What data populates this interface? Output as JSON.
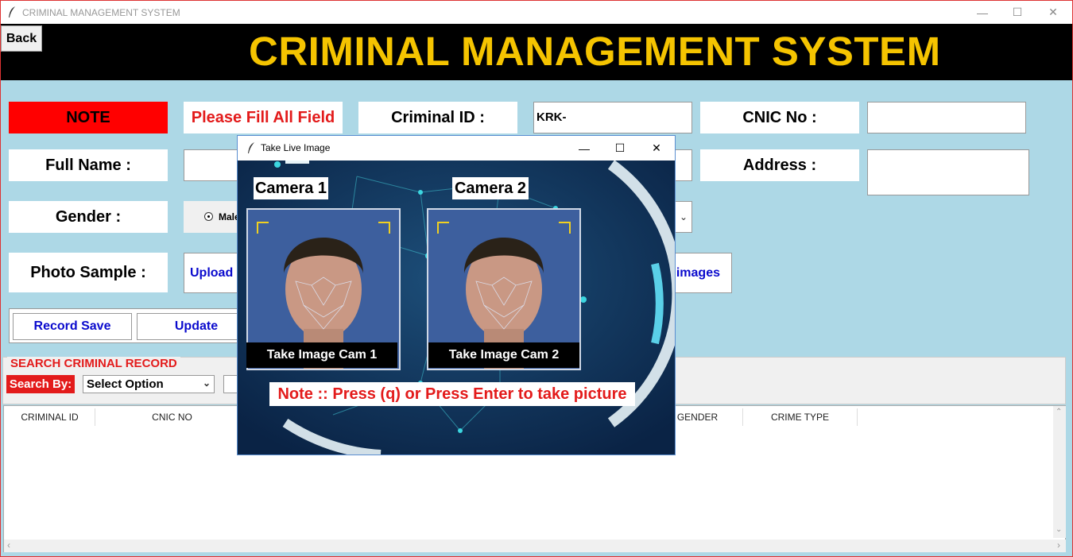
{
  "window": {
    "title": "CRIMINAL MANAGEMENT SYSTEM",
    "minimize": "—",
    "maximize": "☐",
    "close": "✕"
  },
  "header": {
    "back_label": "Back",
    "title": "CRIMINAL MANAGEMENT SYSTEM"
  },
  "form": {
    "note_label": "NOTE",
    "note_text": "Please Fill All Field",
    "criminal_id_label": "Criminal ID :",
    "criminal_id_value": "KRK-",
    "cnic_label": "CNIC No :",
    "cnic_value": "",
    "full_name_label": "Full Name :",
    "full_name_value": "",
    "address_label": "Address :",
    "address_value": "",
    "gender_label": "Gender :",
    "gender_option_male": "Male",
    "photo_label": "Photo Sample :",
    "upload_label": "Upload",
    "images_label": "images",
    "record_save_label": "Record Save",
    "update_label": "Update"
  },
  "search": {
    "frame_title": "SEARCH CRIMINAL RECORD",
    "search_by_label": "Search By:",
    "select_value": "Select Option"
  },
  "table": {
    "columns": [
      "CRIMINAL ID",
      "CNIC NO",
      "GENDER",
      "CRIME TYPE"
    ]
  },
  "dialog": {
    "title": "Take Live Image",
    "camera1_label": "Camera 1",
    "camera2_label": "Camera 2",
    "take_cam1_label": "Take Image Cam 1",
    "take_cam2_label": "Take Image Cam 2",
    "note": "Note :: Press (q)  or Press Enter to take picture"
  },
  "colors": {
    "banner_bg": "#000000",
    "banner_text": "#f5c400",
    "window_bg": "#add8e6",
    "note_red": "#ff0000",
    "link_blue": "#0a0acd"
  }
}
